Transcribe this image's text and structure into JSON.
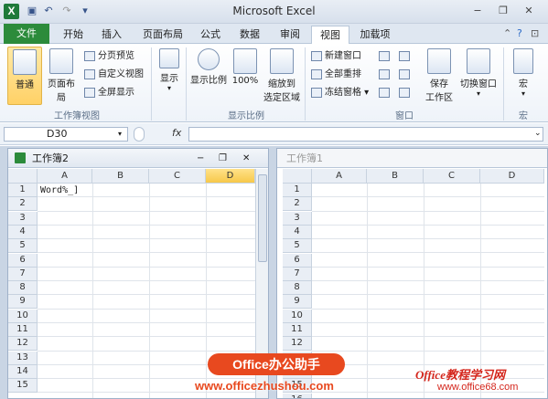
{
  "window": {
    "title": "Microsoft Excel"
  },
  "tabs": [
    "文件",
    "开始",
    "插入",
    "页面布局",
    "公式",
    "数据",
    "审阅",
    "视图",
    "加载项"
  ],
  "active_tab": "视图",
  "ribbon": {
    "groups": [
      {
        "label": "工作簿视图",
        "big": [
          "普通",
          "页面布局"
        ],
        "small": [
          "分页预览",
          "自定义视图",
          "全屏显示"
        ]
      },
      {
        "label": "",
        "big": [
          "显示"
        ]
      },
      {
        "label": "显示比例",
        "big": [
          "显示比例",
          "100%",
          "缩放到",
          "选定区域"
        ]
      },
      {
        "label": "窗口",
        "small": [
          "新建窗口",
          "全部重排",
          "冻结窗格"
        ],
        "big": [
          "保存",
          "工作区",
          "切换窗口"
        ]
      },
      {
        "label": "宏",
        "big": [
          "宏"
        ]
      }
    ]
  },
  "formula_bar": {
    "name_box": "D30",
    "fx": "fx",
    "value": ""
  },
  "panes": [
    {
      "title": "工作簿2",
      "columns": [
        "A",
        "B",
        "C",
        "D"
      ],
      "selected_column": "D",
      "rows": [
        "1",
        "2",
        "3",
        "4",
        "5",
        "6",
        "7",
        "8",
        "9",
        "10",
        "11",
        "12",
        "13",
        "14",
        "15"
      ],
      "cell_A1": "Word%_]"
    },
    {
      "title": "工作簿1",
      "columns": [
        "A",
        "B",
        "C",
        "D"
      ],
      "rows": [
        "1",
        "2",
        "3",
        "4",
        "5",
        "6",
        "7",
        "8",
        "9",
        "10",
        "11",
        "12",
        "13",
        "14",
        "15",
        "16"
      ]
    }
  ],
  "watermarks": {
    "badge": "Office办公助手",
    "url": "www.officezhushou.com",
    "site_name": "Office教程学习网",
    "site_url": "www.office68.com"
  },
  "colors": {
    "file_tab": "#2c8b3b",
    "selected_header": "#f7c84a",
    "watermark": "#e8491f"
  }
}
